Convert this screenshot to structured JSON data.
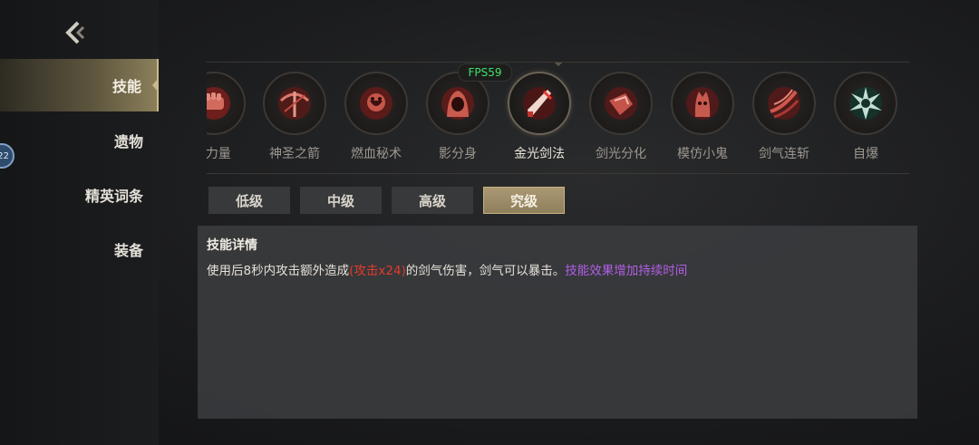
{
  "fps": "FPS59",
  "sidebar": {
    "level_badge": "22",
    "items": [
      {
        "label": "技能",
        "active": true
      },
      {
        "label": "遗物",
        "active": false
      },
      {
        "label": "精英词条",
        "active": false
      },
      {
        "label": "装备",
        "active": false
      }
    ]
  },
  "skills": [
    {
      "name": "X力量",
      "icon": "fist-icon"
    },
    {
      "name": "神圣之箭",
      "icon": "crossbow-icon"
    },
    {
      "name": "燃血秘术",
      "icon": "blood-rage-icon"
    },
    {
      "name": "影分身",
      "icon": "shadow-hood-icon"
    },
    {
      "name": "金光剑法",
      "icon": "golden-sword-icon",
      "selected": true
    },
    {
      "name": "剑光分化",
      "icon": "split-blade-icon"
    },
    {
      "name": "模仿小鬼",
      "icon": "imp-icon"
    },
    {
      "name": "剑气连斩",
      "icon": "slash-icon"
    },
    {
      "name": "自爆",
      "icon": "explosion-icon"
    }
  ],
  "tiers": [
    {
      "label": "低级",
      "active": false
    },
    {
      "label": "中级",
      "active": false
    },
    {
      "label": "高级",
      "active": false
    },
    {
      "label": "究级",
      "active": true
    }
  ],
  "detail": {
    "title": "技能详情",
    "desc_prefix": "使用后8秒内攻击额外造成",
    "desc_highlight": "(攻击x24)",
    "desc_suffix": "的剑气伤害，剑气可以暴击。",
    "desc_bonus": "技能效果增加持续时间"
  },
  "colors": {
    "accent_gold": "#c9b98a",
    "damage_red": "#e23b2e",
    "bonus_purple": "#b25fe6",
    "fps_green": "#3fe06a",
    "skill_red": "#b8332e"
  }
}
